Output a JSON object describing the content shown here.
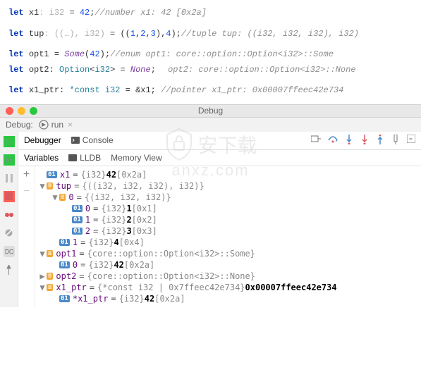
{
  "editor": {
    "l1_kw": "let",
    "l1_var": "x1",
    "l1_hint": ": i32",
    "l1_eq": "=",
    "l1_val": "42",
    "l1_semi": ";",
    "l1_c": "//number  x1: 42 [0x2a]",
    "l2_kw": "let",
    "l2_var": "tup",
    "l2_hint": ": ((…), i32)",
    "l2_eq": "=",
    "l2_o": "((",
    "l2_a": "1",
    "l2_b": "2",
    "l2_cnum": "3",
    "l2_m": "),",
    "l2_d": "4",
    "l2_cl": ");",
    "l2_c": "//tuple  tup: ((i32, i32, i32), i32)",
    "l3_kw": "let",
    "l3_var": "opt1",
    "l3_eq": "=",
    "l3_fn": "Some",
    "l3_o": "(",
    "l3_v": "42",
    "l3_cl": ");",
    "l3_c": "//enum  opt1: core::option::Option<i32>::Some",
    "l4_kw": "let",
    "l4_var": "opt2",
    "l4_col": ":",
    "l4_t": "Option",
    "l4_g": "<",
    "l4_it": "i32",
    "l4_gc": ">",
    "l4_eq": "=",
    "l4_fn": "None",
    "l4_semi": ";",
    "l4_c": "opt2: core::option::Option<i32>::None",
    "l5_kw": "let",
    "l5_var": "x1_ptr",
    "l5_col": ":",
    "l5_t": "*const i32",
    "l5_eq": "=",
    "l5_v": "&x1;",
    "l5_c": "//pointer  x1_ptr: 0x00007ffeec42e734"
  },
  "window": {
    "title": "Debug"
  },
  "header": {
    "label": "Debug:",
    "run": "run"
  },
  "tabs": {
    "debugger": "Debugger",
    "console": "Console"
  },
  "subtabs": {
    "variables": "Variables",
    "lldb": "LLDB",
    "memory": "Memory View"
  },
  "tree": {
    "x1": {
      "name": "x1",
      "type": "{i32}",
      "val": "42",
      "hex": "[0x2a]"
    },
    "tup": {
      "name": "tup",
      "type": "{((i32, i32, i32), i32)}"
    },
    "tup0": {
      "name": "0",
      "type": "{(i32, i32, i32)}"
    },
    "tup00": {
      "name": "0",
      "type": "{i32}",
      "val": "1",
      "hex": "[0x1]"
    },
    "tup01": {
      "name": "1",
      "type": "{i32}",
      "val": "2",
      "hex": "[0x2]"
    },
    "tup02": {
      "name": "2",
      "type": "{i32}",
      "val": "3",
      "hex": "[0x3]"
    },
    "tup1": {
      "name": "1",
      "type": "{i32}",
      "val": "4",
      "hex": "[0x4]"
    },
    "opt1": {
      "name": "opt1",
      "type": "{core::option::Option<i32>::Some}"
    },
    "opt1_0": {
      "name": "0",
      "type": "{i32}",
      "val": "42",
      "hex": "[0x2a]"
    },
    "opt2": {
      "name": "opt2",
      "type": "{core::option::Option<i32>::None}"
    },
    "x1ptr": {
      "name": "x1_ptr",
      "type": "{*const i32 | 0x7ffeec42e734}",
      "val": "0x00007ffeec42e734"
    },
    "x1ptr_d": {
      "name": "*x1_ptr",
      "type": "{i32}",
      "val": "42",
      "hex": "[0x2a]"
    }
  },
  "watermark": {
    "l1": "安下载",
    "l2": "anxz.com"
  }
}
